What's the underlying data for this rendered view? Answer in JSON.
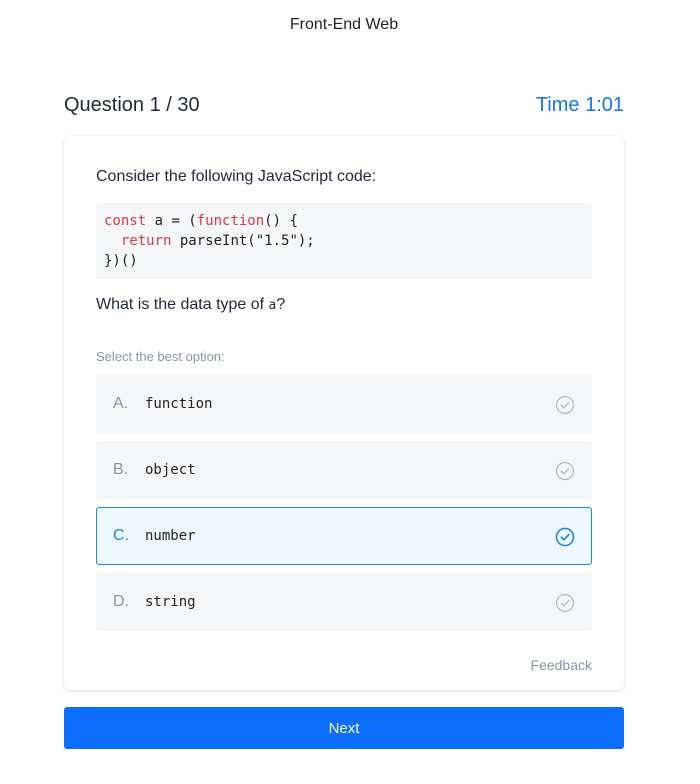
{
  "app": {
    "title": "Front-End Web"
  },
  "header": {
    "question_count": "Question 1 / 30",
    "timer": "Time 1:01"
  },
  "question": {
    "prompt": "Consider the following JavaScript code:",
    "code": {
      "line1": {
        "kw1": "const",
        "rest1": " a = (",
        "kw2": "function",
        "rest2": "() {"
      },
      "line2": {
        "indent": "  ",
        "kw": "return",
        "rest": " parseInt(\"1.5\");"
      },
      "line3": "})()"
    },
    "text_before": "What is the data type of ",
    "inline_code": "a",
    "text_after": "?",
    "select_label": "Select the best option:"
  },
  "options": [
    {
      "letter": "A.",
      "text": "function",
      "selected": false
    },
    {
      "letter": "B.",
      "text": "object",
      "selected": false
    },
    {
      "letter": "C.",
      "text": "number",
      "selected": true
    },
    {
      "letter": "D.",
      "text": "string",
      "selected": false
    }
  ],
  "feedback_label": "Feedback",
  "next_label": "Next",
  "colors": {
    "accent": "#1e88e5",
    "primary_button": "#0d6efd",
    "keyword": "#d73a49",
    "muted": "#8a94a6"
  },
  "icons": {
    "option_check": "check-circle-icon"
  }
}
